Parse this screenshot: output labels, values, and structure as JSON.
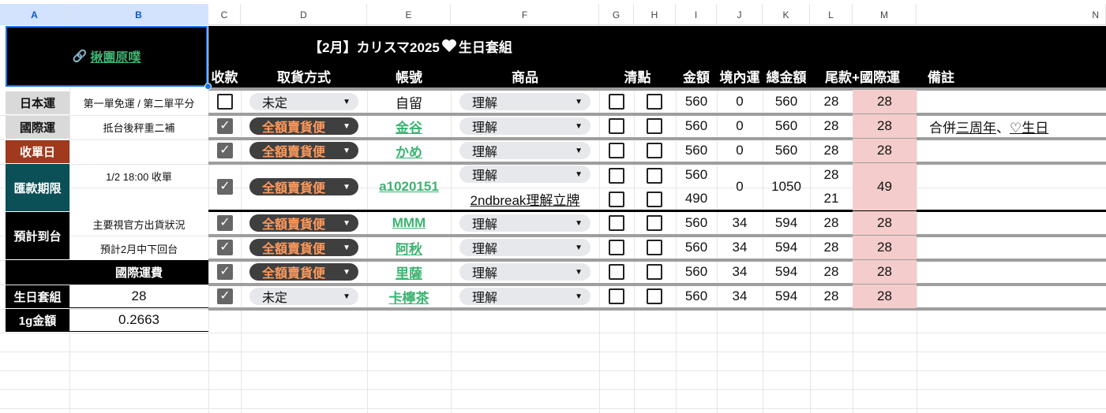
{
  "columns": [
    "A",
    "B",
    "C",
    "D",
    "E",
    "F",
    "G",
    "H",
    "I",
    "J",
    "K",
    "L",
    "M",
    "N"
  ],
  "header": {
    "title": "【2月】カリスマ2025",
    "title_suffix": "生日套組",
    "heart_icon": "white-heart",
    "labels": {
      "received": "收款",
      "pickup": "取貨方式",
      "account": "帳號",
      "product": "商品",
      "check": "清點",
      "amount": "金額",
      "domestic": "境內運",
      "total": "總金額",
      "balance": "尾款+國際運",
      "remark": "備註"
    }
  },
  "left": {
    "logo_link": "揪團原噗",
    "link_icon": "link-icon",
    "jp_label": "日本運",
    "jp_value": "第一單免運 / 第二單平分",
    "intl_label": "國際運",
    "intl_value": "抵台後秤重二補",
    "close_label": "收單日",
    "pay_label": "匯款期限",
    "pay_value": "1/2 18:00 收單",
    "eta_label": "預計到台",
    "eta_value1": "主要視官方出貨狀況",
    "eta_value2": "預計2月中下回台",
    "fee_header": "國際運費",
    "set_label": "生日套組",
    "set_value": "28",
    "gram_label": "1g金額",
    "gram_value": "0.2663"
  },
  "rows": [
    {
      "received": false,
      "pickup": "未定",
      "pickup_style": "gray",
      "account": "自留",
      "account_link": false,
      "product": "理解",
      "amount": "560",
      "domestic": "0",
      "total": "560",
      "balance": "28",
      "intl": "28",
      "remark": ""
    },
    {
      "received": true,
      "pickup": "全額賣貨便",
      "pickup_style": "dark",
      "account": "金谷",
      "account_link": true,
      "product": "理解",
      "amount": "560",
      "domestic": "0",
      "total": "560",
      "balance": "28",
      "intl": "28",
      "remark": "合併三周年、♡生日",
      "remark_parts": [
        "合併",
        "三周年",
        "、",
        "♡生日"
      ]
    },
    {
      "received": true,
      "pickup": "全額賣貨便",
      "pickup_style": "dark",
      "account": "かめ",
      "account_link": true,
      "product": "理解",
      "amount": "560",
      "domestic": "0",
      "total": "560",
      "balance": "28",
      "intl": "28",
      "remark": ""
    },
    {
      "received": true,
      "pickup": "全額賣貨便",
      "pickup_style": "dark",
      "account": "a1020151",
      "account_link": true,
      "product": "理解",
      "product2": "2ndbreak理解立牌",
      "amount": "560",
      "amount2": "490",
      "domestic": "0",
      "total": "1050",
      "balance": "28",
      "balance2": "21",
      "intl": "49",
      "remark": ""
    },
    {
      "received": true,
      "pickup": "全額賣貨便",
      "pickup_style": "dark",
      "account": "MMM",
      "account_link": true,
      "product": "理解",
      "amount": "560",
      "domestic": "34",
      "total": "594",
      "balance": "28",
      "intl": "28",
      "remark": ""
    },
    {
      "received": true,
      "pickup": "全額賣貨便",
      "pickup_style": "dark",
      "account": "阿秋",
      "account_link": true,
      "product": "理解",
      "amount": "560",
      "domestic": "34",
      "total": "594",
      "balance": "28",
      "intl": "28",
      "remark": ""
    },
    {
      "received": true,
      "pickup": "全額賣貨便",
      "pickup_style": "dark",
      "account": "里薩",
      "account_link": true,
      "product": "理解",
      "amount": "560",
      "domestic": "34",
      "total": "594",
      "balance": "28",
      "intl": "28",
      "remark": ""
    },
    {
      "received": true,
      "pickup": "未定",
      "pickup_style": "gray",
      "account": "卡檸茶",
      "account_link": true,
      "product": "理解",
      "amount": "560",
      "domestic": "34",
      "total": "594",
      "balance": "28",
      "intl": "28",
      "remark": ""
    }
  ],
  "colors": {
    "accent_link": "#3cb371",
    "pink": "#f4cccc",
    "dark_pill": "#3f3f3f",
    "orange_text": "#ff9a5c",
    "label_red": "#a0391d",
    "label_teal": "#0b4f57"
  }
}
